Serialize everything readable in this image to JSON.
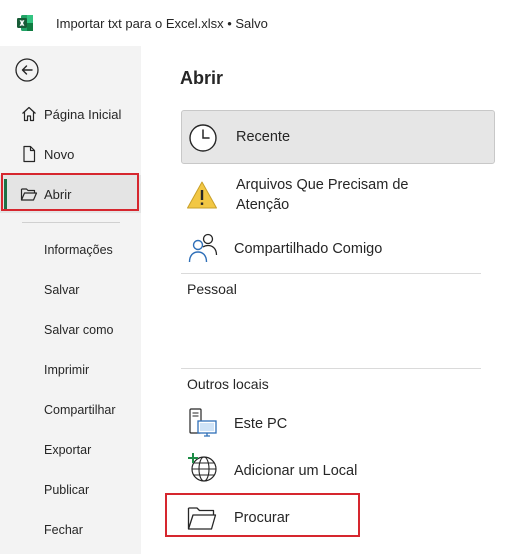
{
  "window": {
    "title": "Importar txt para o Excel.xlsx • Salvo",
    "app_icon": "excel-logo-icon",
    "accent_color": "#1e7145",
    "highlight_color": "#d6262e"
  },
  "sidebar": {
    "back_icon": "back-arrow-icon",
    "primary": [
      {
        "label": "Página Inicial",
        "icon": "home-icon"
      },
      {
        "label": "Novo",
        "icon": "new-document-icon"
      },
      {
        "label": "Abrir",
        "icon": "open-folder-icon",
        "active": true
      }
    ],
    "secondary": [
      {
        "label": "Informações"
      },
      {
        "label": "Salvar"
      },
      {
        "label": "Salvar como"
      },
      {
        "label": "Imprimir"
      },
      {
        "label": "Compartilhar"
      },
      {
        "label": "Exportar"
      },
      {
        "label": "Publicar"
      },
      {
        "label": "Fechar"
      }
    ]
  },
  "main": {
    "title": "Abrir",
    "locations": [
      {
        "label": "Recente",
        "icon": "clock-icon",
        "selected": true
      },
      {
        "label_line1": "Arquivos Que Precisam de",
        "label_line2": "Atenção",
        "icon": "warning-icon"
      },
      {
        "label": "Compartilhado Comigo",
        "icon": "people-icon"
      }
    ],
    "personal_heading": "Pessoal",
    "other_heading": "Outros locais",
    "other_locations": [
      {
        "label": "Este PC",
        "icon": "computer-icon"
      },
      {
        "label": "Adicionar um Local",
        "icon": "add-location-globe-icon"
      },
      {
        "label": "Procurar",
        "icon": "browse-folder-icon"
      }
    ]
  }
}
